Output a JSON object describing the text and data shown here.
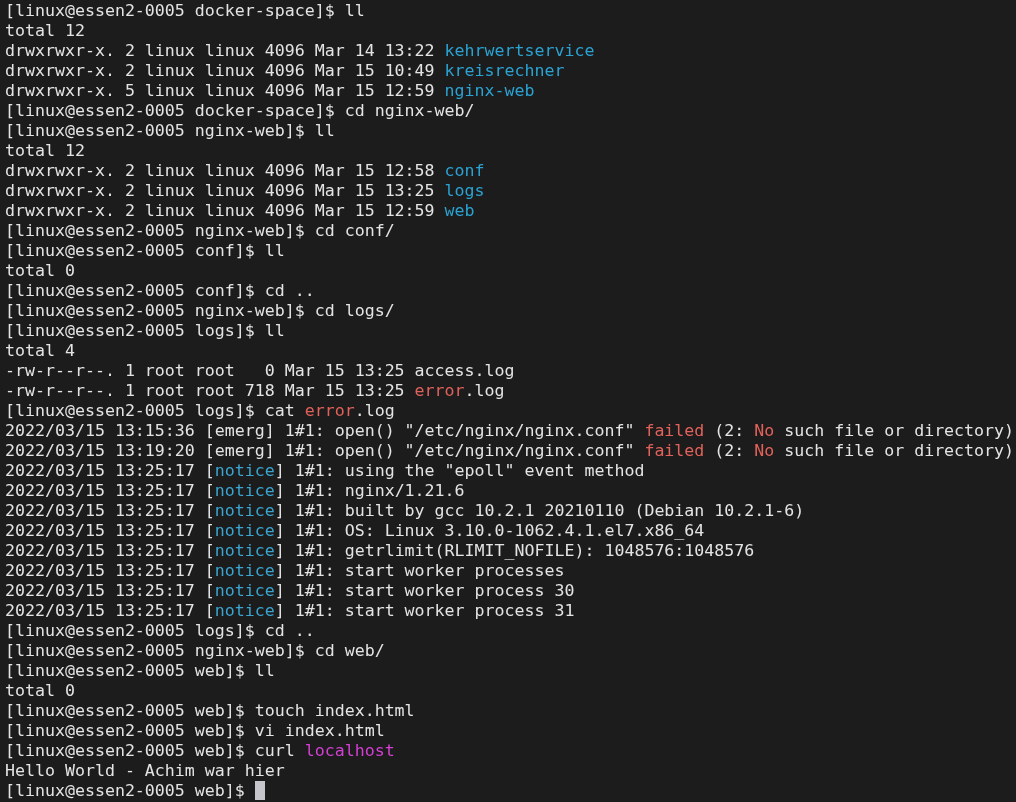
{
  "terminal": {
    "cursor_visible": true,
    "lines": [
      {
        "segments": [
          {
            "text": "[linux@essen2-0005 docker-space]$ ll",
            "kind": "plain"
          }
        ]
      },
      {
        "segments": [
          {
            "text": "total 12",
            "kind": "plain"
          }
        ]
      },
      {
        "segments": [
          {
            "text": "drwxrwxr-x. 2 linux linux 4096 Mar 14 13:22 ",
            "kind": "plain"
          },
          {
            "text": "kehrwertservice",
            "kind": "directory"
          }
        ]
      },
      {
        "segments": [
          {
            "text": "drwxrwxr-x. 2 linux linux 4096 Mar 15 10:49 ",
            "kind": "plain"
          },
          {
            "text": "kreisrechner",
            "kind": "directory"
          }
        ]
      },
      {
        "segments": [
          {
            "text": "drwxrwxr-x. 5 linux linux 4096 Mar 15 12:59 ",
            "kind": "plain"
          },
          {
            "text": "nginx-web",
            "kind": "directory"
          }
        ]
      },
      {
        "segments": [
          {
            "text": "[linux@essen2-0005 docker-space]$ cd nginx-web/",
            "kind": "plain"
          }
        ]
      },
      {
        "segments": [
          {
            "text": "[linux@essen2-0005 nginx-web]$ ll",
            "kind": "plain"
          }
        ]
      },
      {
        "segments": [
          {
            "text": "total 12",
            "kind": "plain"
          }
        ]
      },
      {
        "segments": [
          {
            "text": "drwxrwxr-x. 2 linux linux 4096 Mar 15 12:58 ",
            "kind": "plain"
          },
          {
            "text": "conf",
            "kind": "directory"
          }
        ]
      },
      {
        "segments": [
          {
            "text": "drwxrwxr-x. 2 linux linux 4096 Mar 15 13:25 ",
            "kind": "plain"
          },
          {
            "text": "logs",
            "kind": "directory"
          }
        ]
      },
      {
        "segments": [
          {
            "text": "drwxrwxr-x. 2 linux linux 4096 Mar 15 12:59 ",
            "kind": "plain"
          },
          {
            "text": "web",
            "kind": "directory"
          }
        ]
      },
      {
        "segments": [
          {
            "text": "[linux@essen2-0005 nginx-web]$ cd conf/",
            "kind": "plain"
          }
        ]
      },
      {
        "segments": [
          {
            "text": "[linux@essen2-0005 conf]$ ll",
            "kind": "plain"
          }
        ]
      },
      {
        "segments": [
          {
            "text": "total 0",
            "kind": "plain"
          }
        ]
      },
      {
        "segments": [
          {
            "text": "[linux@essen2-0005 conf]$ cd ..",
            "kind": "plain"
          }
        ]
      },
      {
        "segments": [
          {
            "text": "[linux@essen2-0005 nginx-web]$ cd logs/",
            "kind": "plain"
          }
        ]
      },
      {
        "segments": [
          {
            "text": "[linux@essen2-0005 logs]$ ll",
            "kind": "plain"
          }
        ]
      },
      {
        "segments": [
          {
            "text": "total 4",
            "kind": "plain"
          }
        ]
      },
      {
        "segments": [
          {
            "text": "-rw-r--r--. 1 root root   0 Mar 15 13:25 access.log",
            "kind": "plain"
          }
        ]
      },
      {
        "segments": [
          {
            "text": "-rw-r--r--. 1 root root 718 Mar 15 13:25 ",
            "kind": "plain"
          },
          {
            "text": "error",
            "kind": "error"
          },
          {
            "text": ".log",
            "kind": "plain"
          }
        ]
      },
      {
        "segments": [
          {
            "text": "[linux@essen2-0005 logs]$ cat ",
            "kind": "plain"
          },
          {
            "text": "error",
            "kind": "error"
          },
          {
            "text": ".log",
            "kind": "plain"
          }
        ]
      },
      {
        "segments": [
          {
            "text": "2022/03/15 13:15:36 [emerg] 1#1: open() \"/etc/nginx/nginx.conf\" ",
            "kind": "plain"
          },
          {
            "text": "failed",
            "kind": "error"
          },
          {
            "text": " (2: ",
            "kind": "plain"
          },
          {
            "text": "No",
            "kind": "error"
          },
          {
            "text": " such file or directory)",
            "kind": "plain"
          }
        ]
      },
      {
        "segments": [
          {
            "text": "2022/03/15 13:19:20 [emerg] 1#1: open() \"/etc/nginx/nginx.conf\" ",
            "kind": "plain"
          },
          {
            "text": "failed",
            "kind": "error"
          },
          {
            "text": " (2: ",
            "kind": "plain"
          },
          {
            "text": "No",
            "kind": "error"
          },
          {
            "text": " such file or directory)",
            "kind": "plain"
          }
        ]
      },
      {
        "segments": [
          {
            "text": "2022/03/15 13:25:17 [",
            "kind": "plain"
          },
          {
            "text": "notice",
            "kind": "notice"
          },
          {
            "text": "] 1#1: using the \"epoll\" event method",
            "kind": "plain"
          }
        ]
      },
      {
        "segments": [
          {
            "text": "2022/03/15 13:25:17 [",
            "kind": "plain"
          },
          {
            "text": "notice",
            "kind": "notice"
          },
          {
            "text": "] 1#1: nginx/1.21.6",
            "kind": "plain"
          }
        ]
      },
      {
        "segments": [
          {
            "text": "2022/03/15 13:25:17 [",
            "kind": "plain"
          },
          {
            "text": "notice",
            "kind": "notice"
          },
          {
            "text": "] 1#1: built by gcc 10.2.1 20210110 (Debian 10.2.1-6)",
            "kind": "plain"
          }
        ]
      },
      {
        "segments": [
          {
            "text": "2022/03/15 13:25:17 [",
            "kind": "plain"
          },
          {
            "text": "notice",
            "kind": "notice"
          },
          {
            "text": "] 1#1: OS: Linux 3.10.0-1062.4.1.el7.x86_64",
            "kind": "plain"
          }
        ]
      },
      {
        "segments": [
          {
            "text": "2022/03/15 13:25:17 [",
            "kind": "plain"
          },
          {
            "text": "notice",
            "kind": "notice"
          },
          {
            "text": "] 1#1: getrlimit(RLIMIT_NOFILE): 1048576:1048576",
            "kind": "plain"
          }
        ]
      },
      {
        "segments": [
          {
            "text": "2022/03/15 13:25:17 [",
            "kind": "plain"
          },
          {
            "text": "notice",
            "kind": "notice"
          },
          {
            "text": "] 1#1: start worker processes",
            "kind": "plain"
          }
        ]
      },
      {
        "segments": [
          {
            "text": "2022/03/15 13:25:17 [",
            "kind": "plain"
          },
          {
            "text": "notice",
            "kind": "notice"
          },
          {
            "text": "] 1#1: start worker process 30",
            "kind": "plain"
          }
        ]
      },
      {
        "segments": [
          {
            "text": "2022/03/15 13:25:17 [",
            "kind": "plain"
          },
          {
            "text": "notice",
            "kind": "notice"
          },
          {
            "text": "] 1#1: start worker process 31",
            "kind": "plain"
          }
        ]
      },
      {
        "segments": [
          {
            "text": "[linux@essen2-0005 logs]$ cd ..",
            "kind": "plain"
          }
        ]
      },
      {
        "segments": [
          {
            "text": "[linux@essen2-0005 nginx-web]$ cd web/",
            "kind": "plain"
          }
        ]
      },
      {
        "segments": [
          {
            "text": "[linux@essen2-0005 web]$ ll",
            "kind": "plain"
          }
        ]
      },
      {
        "segments": [
          {
            "text": "total 0",
            "kind": "plain"
          }
        ]
      },
      {
        "segments": [
          {
            "text": "[linux@essen2-0005 web]$ touch index.html",
            "kind": "plain"
          }
        ]
      },
      {
        "segments": [
          {
            "text": "[linux@essen2-0005 web]$ vi index.html",
            "kind": "plain"
          }
        ]
      },
      {
        "segments": [
          {
            "text": "[linux@essen2-0005 web]$ curl ",
            "kind": "plain"
          },
          {
            "text": "localhost",
            "kind": "host"
          }
        ]
      },
      {
        "segments": [
          {
            "text": "Hello World - Achim war hier",
            "kind": "plain"
          }
        ]
      },
      {
        "segments": [
          {
            "text": "[linux@essen2-0005 web]$ ",
            "kind": "plain"
          }
        ]
      }
    ]
  }
}
